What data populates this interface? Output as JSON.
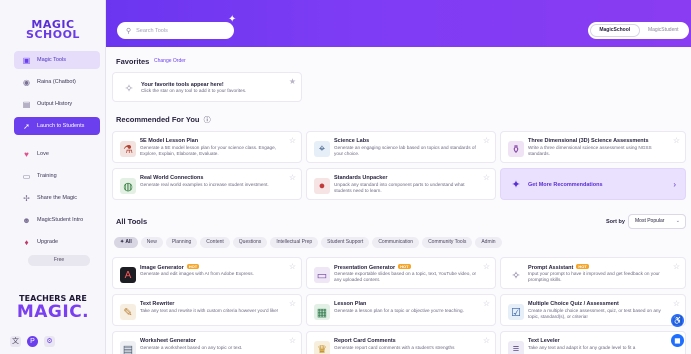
{
  "sidebar": {
    "logo_line1": "MAGIC",
    "logo_line2": "SCHOOL",
    "items": [
      {
        "label": "Magic Tools",
        "icon": "toolbox-icon"
      },
      {
        "label": "Raina (Chatbot)",
        "icon": "chatbot-icon"
      },
      {
        "label": "Output History",
        "icon": "history-icon"
      },
      {
        "label": "Launch to Students",
        "icon": "rocket-icon"
      },
      {
        "label": "Love",
        "icon": "heart-icon"
      },
      {
        "label": "Training",
        "icon": "training-icon"
      },
      {
        "label": "Share the Magic",
        "icon": "share-icon"
      },
      {
        "label": "MagicStudent Intro",
        "icon": "student-icon"
      },
      {
        "label": "Upgrade",
        "icon": "upgrade-icon"
      }
    ],
    "free_label": "Free",
    "teachers_line1": "TEACHERS ARE",
    "teachers_line2": "MAGIC."
  },
  "header": {
    "search_placeholder": "Search Tools",
    "toggle": [
      "MagicSchool",
      "MagicStudent"
    ]
  },
  "favorites": {
    "heading": "Favorites",
    "link": "Change Order",
    "card_title": "Your favorite tools appear here!",
    "card_desc": "Click the star on any tool to add it to your favorites."
  },
  "recommended": {
    "heading": "Recommended For You",
    "cards": [
      {
        "title": "5E Model Lesson Plan",
        "desc": "Generate a 5E model lesson plan for your science class. Engage, Explore, Explain, Elaborate, Evaluate."
      },
      {
        "title": "Science Labs",
        "desc": "Generate an engaging science lab based on topics and standards of your choice."
      },
      {
        "title": "Three Dimensional (3D) Science Assessments",
        "desc": "Write a three dimensional science assessment using NGSS standards."
      },
      {
        "title": "Real World Connections",
        "desc": "Generate real world examples to increase student investment."
      },
      {
        "title": "Standards Unpacker",
        "desc": "Unpack any standard into component parts to understand what students need to learn."
      }
    ],
    "more_label": "Get More Recommendations"
  },
  "all_tools": {
    "heading": "All Tools",
    "sort_label": "Sort by",
    "sort_value": "Most Popular",
    "chips": [
      "All",
      "New",
      "Planning",
      "Content",
      "Questions",
      "Intellectual Prep",
      "Student Support",
      "Communication",
      "Community Tools",
      "Admin"
    ],
    "hot_label": "HOT",
    "cards": [
      {
        "title": "Image Generator",
        "desc": "Generate and edit images with AI from Adobe Express."
      },
      {
        "title": "Presentation Generator",
        "desc": "Generate exportable slides based on a topic, text, YouTube video, or any uploaded content."
      },
      {
        "title": "Prompt Assistant",
        "desc": "Input your prompt to have it improved and get feedback on your prompting skills."
      },
      {
        "title": "Text Rewriter",
        "desc": "Take any text and rewrite it with custom criteria however you'd like!"
      },
      {
        "title": "Lesson Plan",
        "desc": "Generate a lesson plan for a topic or objective you're teaching."
      },
      {
        "title": "Multiple Choice Quiz / Assessment",
        "desc": "Create a multiple choice assessment, quiz, or test based on any topic, standard(s), or criteria!"
      },
      {
        "title": "Worksheet Generator",
        "desc": "Generate a worksheet based on any topic or text."
      },
      {
        "title": "Report Card Comments",
        "desc": "Generate report card comments with a student's strengths"
      },
      {
        "title": "Text Leveler",
        "desc": "Take any text and adapt it for any grade level to fit a"
      }
    ]
  },
  "colors": {
    "brand": "#6b35f0",
    "accent": "#7a3ff0",
    "hot": "#f4a52a"
  }
}
